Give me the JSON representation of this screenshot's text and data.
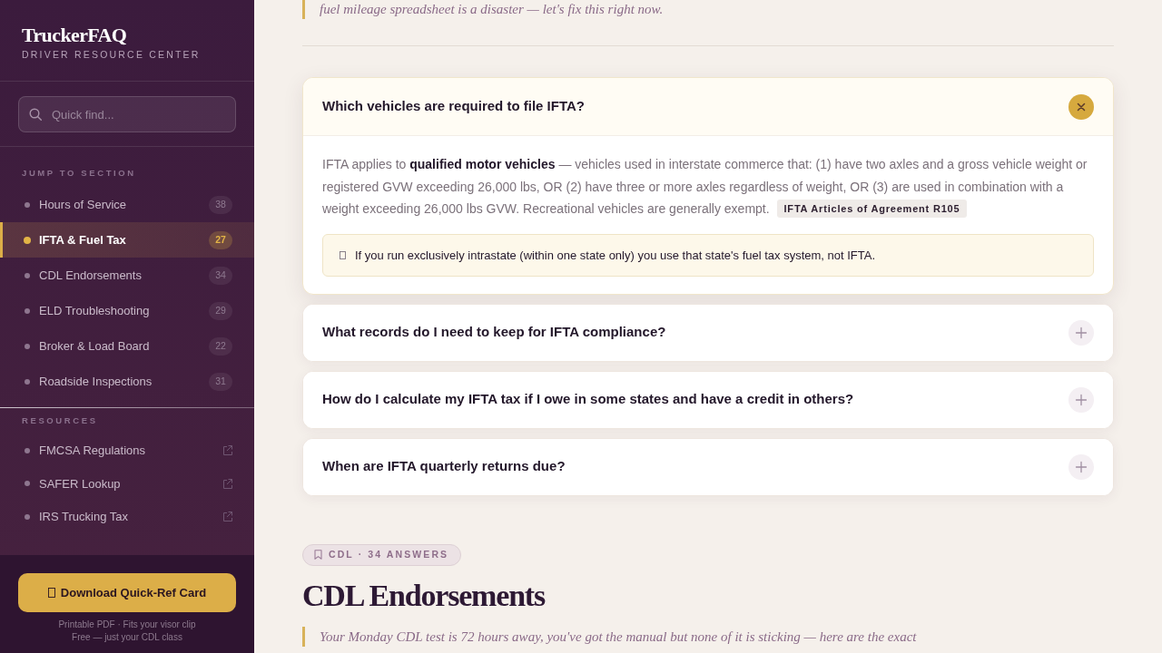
{
  "sidebar": {
    "brand": "TruckerFAQ",
    "tagline": "DRIVER RESOURCE CENTER",
    "search": {
      "placeholder": "Quick find..."
    },
    "sections_heading": "JUMP TO SECTION",
    "sections": [
      {
        "label": "Hours of Service",
        "count": "38",
        "selected": false
      },
      {
        "label": "IFTA & Fuel Tax",
        "count": "27",
        "selected": true
      },
      {
        "label": "CDL Endorsements",
        "count": "34",
        "selected": false
      },
      {
        "label": "ELD Troubleshooting",
        "count": "29",
        "selected": false
      },
      {
        "label": "Broker & Load Board",
        "count": "22",
        "selected": false
      },
      {
        "label": "Roadside Inspections",
        "count": "31",
        "selected": false
      }
    ],
    "resources_heading": "RESOURCES",
    "resources": [
      {
        "label": "FMCSA Regulations"
      },
      {
        "label": "SAFER Lookup"
      },
      {
        "label": "IRS Trucking Tax"
      }
    ],
    "download_button": "Download Quick-Ref Card",
    "footnotes": [
      "Printable PDF · Fits your visor clip",
      "Free — just your CDL class"
    ]
  },
  "main": {
    "intro_quote": "fuel mileage spreadsheet is a disaster — let's fix this right now.",
    "faqs": [
      {
        "question": "Which vehicles are required to file IFTA?",
        "expanded": true,
        "answer": "IFTA applies to **qualified motor vehicles** — vehicles used in interstate commerce that: (1) have two axles and a gross vehicle weight or registered GVW exceeding 26,000 lbs, OR (2) have three or more axles regardless of weight, OR (3) are used in combination with a weight exceeding 26,000 lbs GVW. Recreational vehicles are generally exempt.",
        "reference": "IFTA Articles of Agreement R105",
        "note": "If you run exclusively intrastate (within one state only) you use that state's fuel tax system, not IFTA."
      },
      {
        "question": "What records do I need to keep for IFTA compliance?",
        "expanded": false
      },
      {
        "question": "How do I calculate my IFTA tax if I owe in some states and have a credit in others?",
        "expanded": false
      },
      {
        "question": "When are IFTA quarterly returns due?",
        "expanded": false
      }
    ],
    "next_section": {
      "badge": "CDL · 34 ANSWERS",
      "title": "CDL Endorsements",
      "quote": "Your Monday CDL test is 72 hours away, you've got the manual but none of it is sticking — here are the exact"
    }
  }
}
